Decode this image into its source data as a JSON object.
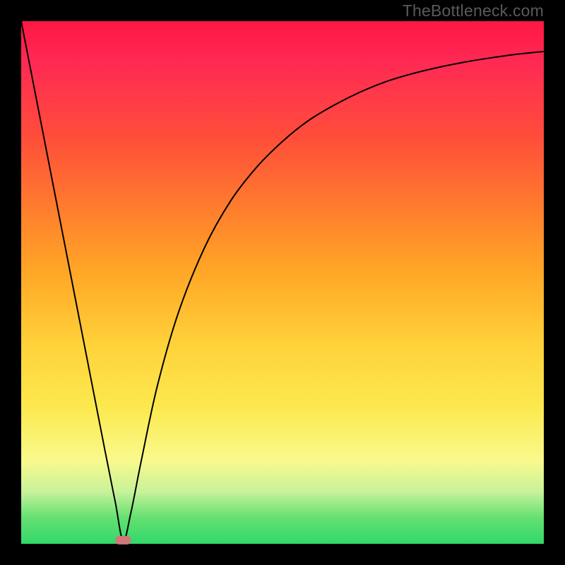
{
  "watermark": "TheBottleneck.com",
  "gradient_colors": {
    "top": "#ff1744",
    "upper_mid": "#ffa726",
    "mid": "#ffd23a",
    "lower_mid": "#f9f98c",
    "bottom": "#32d86a"
  },
  "marker": {
    "color": "#d07878",
    "x_frac": 0.195,
    "y_frac": 0.993
  },
  "chart_data": {
    "type": "line",
    "title": "",
    "xlabel": "",
    "ylabel": "",
    "xlim": [
      0,
      1
    ],
    "ylim": [
      0,
      1
    ],
    "legend": false,
    "grid": false,
    "note": "Bottleneck-style curve. x and y are normalized fractions of the plot area (0 = left/bottom, 1 = right/top). Minimum (best match) at x≈0.20 where the curve touches the bottom; a pink marker sits there.",
    "series": [
      {
        "name": "curve",
        "x": [
          0.0,
          0.04,
          0.08,
          0.12,
          0.16,
          0.18,
          0.195,
          0.21,
          0.23,
          0.26,
          0.3,
          0.35,
          0.4,
          0.45,
          0.5,
          0.55,
          0.6,
          0.65,
          0.7,
          0.75,
          0.8,
          0.85,
          0.9,
          0.95,
          1.0
        ],
        "y": [
          1.0,
          0.795,
          0.59,
          0.385,
          0.18,
          0.08,
          0.006,
          0.06,
          0.16,
          0.3,
          0.44,
          0.565,
          0.655,
          0.72,
          0.77,
          0.81,
          0.84,
          0.865,
          0.885,
          0.9,
          0.912,
          0.922,
          0.93,
          0.937,
          0.942
        ]
      }
    ],
    "annotations": [
      {
        "type": "marker",
        "shape": "pill",
        "x": 0.195,
        "y": 0.006,
        "color": "#d07878"
      }
    ]
  }
}
